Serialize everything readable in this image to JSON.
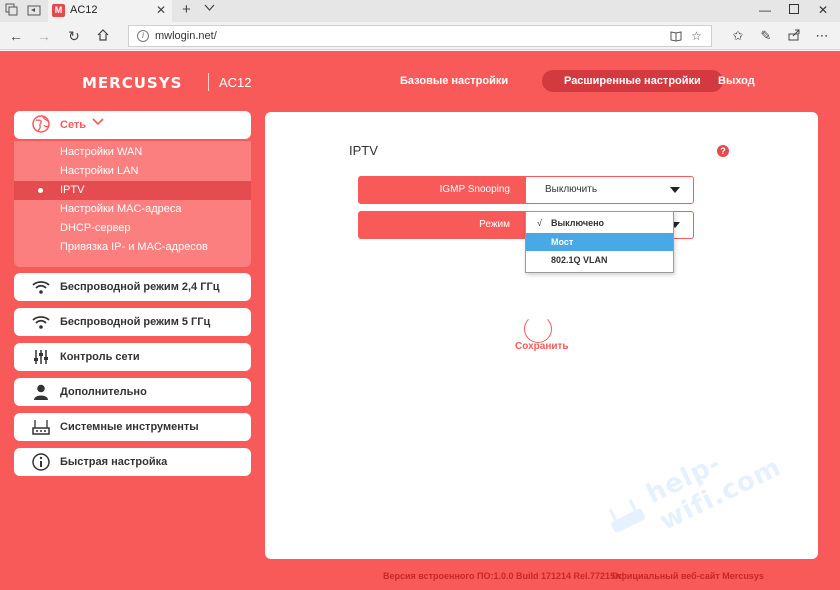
{
  "browser": {
    "tab_title": "AC12",
    "tab_favicon": "M",
    "url": "mwlogin.net/"
  },
  "router": {
    "logo": "MERCUSYS",
    "model": "AC12",
    "top_nav": [
      "Базовые настройки",
      "Расширенные настройки",
      "Выход"
    ],
    "sidebar": {
      "expanded_label": "Сеть",
      "sub_items": [
        "Настройки WAN",
        "Настройки LAN",
        "IPTV",
        "Настройки MAC-адреса",
        "DHCP-сервер",
        "Привязка IP- и MAC-адресов"
      ],
      "sections": [
        "Беспроводной режим 2,4 ГГц",
        "Беспроводной режим 5 ГГц",
        "Контроль сети",
        "Дополнительно",
        "Системные инструменты",
        "Быстрая настройка"
      ]
    },
    "panel": {
      "title": "IPTV",
      "help_glyph": "?",
      "igmp_label": "IGMP Snooping",
      "igmp_value": "Выключить",
      "mode_label": "Режим",
      "mode_options": [
        "Выключено",
        "Мост",
        "802.1Q VLAN"
      ],
      "check_mark": "√",
      "save": "Сохранить"
    },
    "footer": {
      "firmware": "Версия встроенного ПО:1.0.0 Build 171214 Rel.77215n",
      "site": "Официальный веб-сайт Mercusys"
    }
  },
  "watermark": "help-wifi.com",
  "colors": {
    "brand": "#f85a5a",
    "active_nav": "#d23a40",
    "submenu": "#fb7f7f",
    "highlight": "#4aa8e6"
  }
}
